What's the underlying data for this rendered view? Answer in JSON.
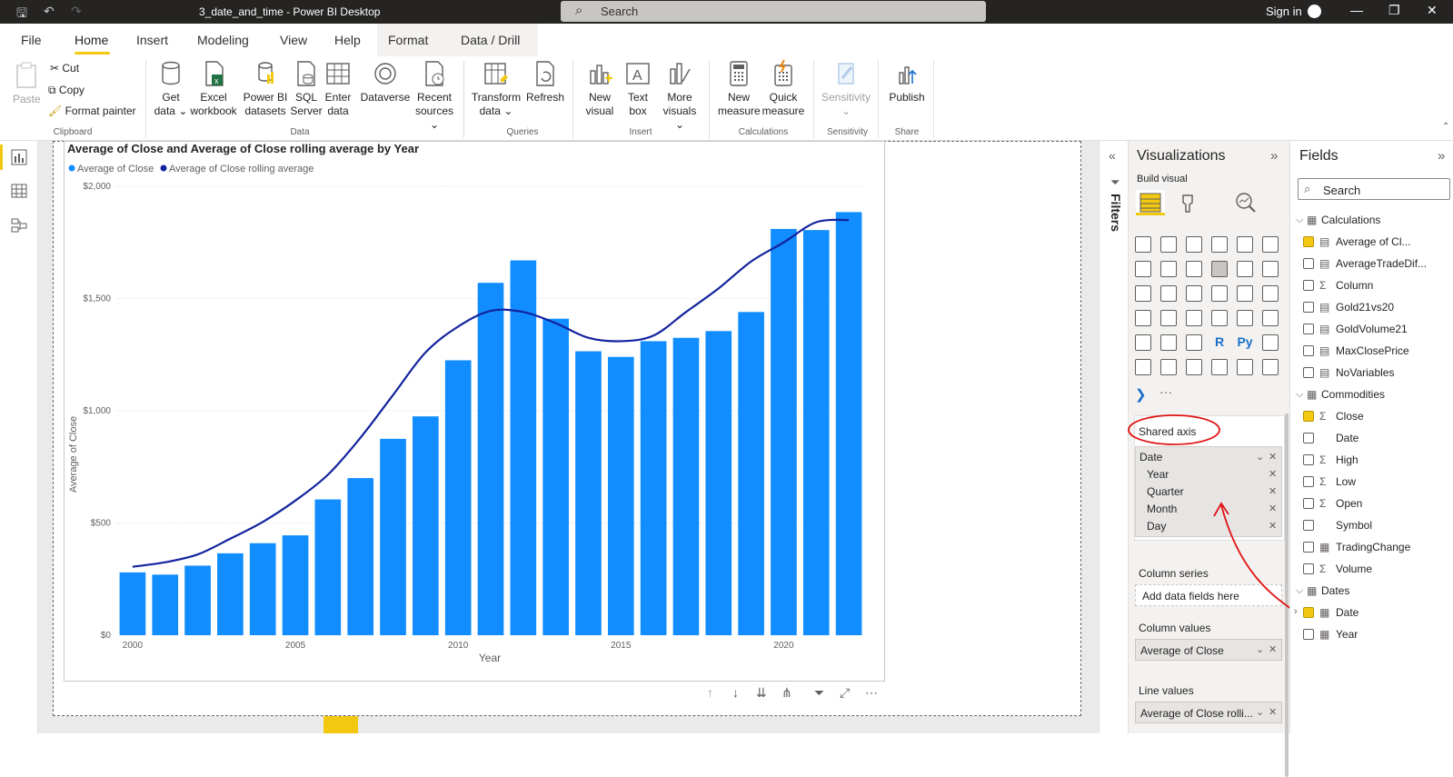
{
  "window": {
    "title": "3_date_and_time - Power BI Desktop",
    "search_placeholder": "Search",
    "sign_in": "Sign in"
  },
  "menu": {
    "items": [
      "File",
      "Home",
      "Insert",
      "Modeling",
      "View",
      "Help",
      "Format",
      "Data / Drill"
    ]
  },
  "ribbon": {
    "clipboard": {
      "paste": "Paste",
      "cut": "Cut",
      "copy": "Copy",
      "format_painter": "Format painter",
      "group": "Clipboard"
    },
    "data": {
      "get_data": [
        "Get",
        "data ⌄"
      ],
      "excel": [
        "Excel",
        "workbook"
      ],
      "pbi": [
        "Power BI",
        "datasets"
      ],
      "sql": [
        "SQL",
        "Server"
      ],
      "enter": [
        "Enter",
        "data"
      ],
      "dataverse": [
        "Dataverse",
        ""
      ],
      "recent": [
        "Recent",
        "sources ⌄"
      ],
      "group": "Data"
    },
    "queries": {
      "transform": [
        "Transform",
        "data ⌄"
      ],
      "refresh": [
        "Refresh",
        ""
      ],
      "group": "Queries"
    },
    "insert": {
      "new_visual": [
        "New",
        "visual"
      ],
      "text_box": [
        "Text",
        "box"
      ],
      "more": [
        "More",
        "visuals ⌄"
      ],
      "group": "Insert"
    },
    "calculations": {
      "new_measure": [
        "New",
        "measure"
      ],
      "quick_measure": [
        "Quick",
        "measure"
      ],
      "group": "Calculations"
    },
    "sensitivity": {
      "label": [
        "Sensitivity",
        "⌄"
      ],
      "group": "Sensitivity"
    },
    "share": {
      "publish": "Publish",
      "group": "Share"
    }
  },
  "chart_data": {
    "type": "bar",
    "title": "Average of Close and Average of Close rolling average by Year",
    "xlabel": "Year",
    "ylabel": "Average of Close",
    "ylim": [
      0,
      2000
    ],
    "yticks": [
      "$0",
      "$500",
      "$1,000",
      "$1,500",
      "$2,000"
    ],
    "xticks": [
      "2000",
      "2005",
      "2010",
      "2015",
      "2020"
    ],
    "legend_position": "top-left",
    "categories": [
      2000,
      2001,
      2002,
      2003,
      2004,
      2005,
      2006,
      2007,
      2008,
      2009,
      2010,
      2011,
      2012,
      2013,
      2014,
      2015,
      2016,
      2017,
      2018,
      2019,
      2020,
      2021,
      2022
    ],
    "series": [
      {
        "name": "Average of Close",
        "kind": "bar",
        "color": "#118DFF",
        "values": [
          280,
          270,
          310,
          365,
          410,
          445,
          605,
          700,
          875,
          975,
          1225,
          1570,
          1670,
          1410,
          1265,
          1240,
          1310,
          1325,
          1355,
          1440,
          1810,
          1805,
          1885
        ]
      },
      {
        "name": "Average of Close rolling average",
        "kind": "line",
        "color": "#12239E",
        "values": [
          305,
          325,
          360,
          430,
          505,
          600,
          715,
          880,
          1070,
          1260,
          1375,
          1445,
          1440,
          1390,
          1325,
          1310,
          1335,
          1440,
          1545,
          1665,
          1750,
          1840,
          1850
        ]
      }
    ]
  },
  "visualizations": {
    "title": "Visualizations",
    "build_visual": "Build visual",
    "shared_axis": "Shared axis",
    "date_field": "Date",
    "date_levels": [
      "Year",
      "Quarter",
      "Month",
      "Day"
    ],
    "column_series": "Column series",
    "add_fields": "Add data fields here",
    "column_values": "Column values",
    "column_value": "Average of Close",
    "line_values": "Line values",
    "line_value": "Average of Close rolli...",
    "more": "···"
  },
  "filters_label": "Filters",
  "fields": {
    "title": "Fields",
    "search": "Search",
    "tables": [
      {
        "name": "Calculations",
        "items": [
          {
            "name": "Average of Cl...",
            "checked": true,
            "icon": "calc"
          },
          {
            "name": "AverageTradeDif...",
            "checked": false,
            "icon": "calc"
          },
          {
            "name": "Column",
            "checked": false,
            "icon": "sigma"
          },
          {
            "name": "Gold21vs20",
            "checked": false,
            "icon": "calc"
          },
          {
            "name": "GoldVolume21",
            "checked": false,
            "icon": "calc"
          },
          {
            "name": "MaxClosePrice",
            "checked": false,
            "icon": "calc"
          },
          {
            "name": "NoVariables",
            "checked": false,
            "icon": "calc"
          }
        ]
      },
      {
        "name": "Commodities",
        "items": [
          {
            "name": "Close",
            "checked": true,
            "icon": "sigma"
          },
          {
            "name": "Date",
            "checked": false,
            "icon": "none"
          },
          {
            "name": "High",
            "checked": false,
            "icon": "sigma"
          },
          {
            "name": "Low",
            "checked": false,
            "icon": "sigma"
          },
          {
            "name": "Open",
            "checked": false,
            "icon": "sigma"
          },
          {
            "name": "Symbol",
            "checked": false,
            "icon": "none"
          },
          {
            "name": "TradingChange",
            "checked": false,
            "icon": "table"
          },
          {
            "name": "Volume",
            "checked": false,
            "icon": "sigma"
          }
        ]
      },
      {
        "name": "Dates",
        "items": [
          {
            "name": "Date",
            "checked": true,
            "icon": "table"
          },
          {
            "name": "Year",
            "checked": false,
            "icon": "table"
          }
        ]
      }
    ]
  }
}
